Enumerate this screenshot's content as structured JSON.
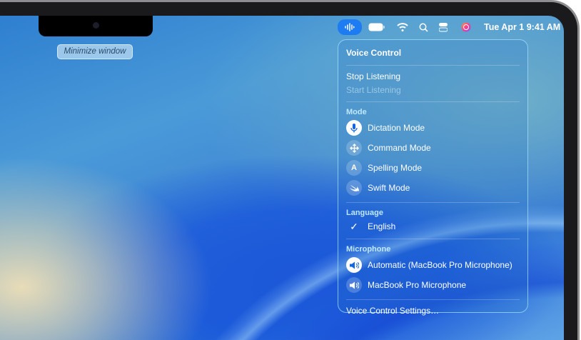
{
  "menubar": {
    "clock": "Tue Apr 1 9:41 AM",
    "icons": [
      "voice-control-icon",
      "battery-icon",
      "wifi-icon",
      "search-icon",
      "control-center-icon",
      "siri-icon"
    ]
  },
  "tooltip": "Minimize window",
  "menu": {
    "title": "Voice Control",
    "stop": "Stop Listening",
    "start": "Start Listening",
    "mode_header": "Mode",
    "modes": [
      {
        "label": "Dictation Mode",
        "icon": "microphone-icon",
        "selected": true
      },
      {
        "label": "Command Mode",
        "icon": "move-arrows-icon",
        "selected": false
      },
      {
        "label": "Spelling Mode",
        "icon": "letter-a-icon",
        "glyph": "A",
        "selected": false
      },
      {
        "label": "Swift Mode",
        "icon": "swift-icon",
        "selected": false
      }
    ],
    "language_header": "Language",
    "language": "English",
    "microphone_header": "Microphone",
    "microphones": [
      {
        "label": "Automatic (MacBook Pro Microphone)",
        "selected": true
      },
      {
        "label": "MacBook Pro Microphone",
        "selected": false
      }
    ],
    "settings": "Voice Control Settings…"
  }
}
